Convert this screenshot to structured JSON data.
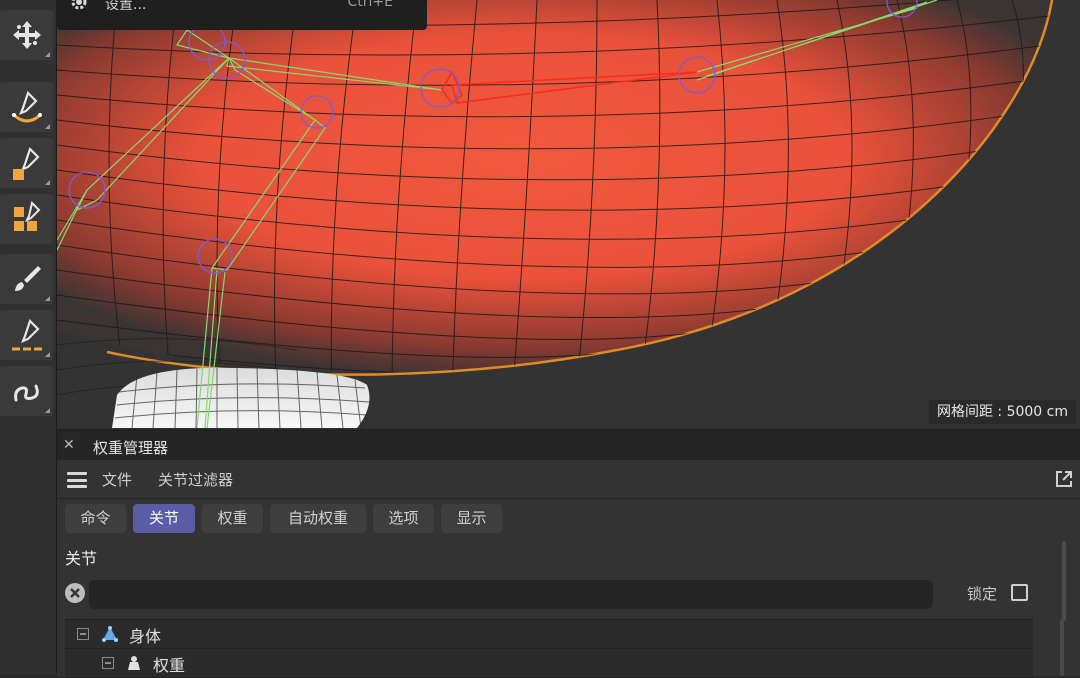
{
  "toolbar": {
    "tools": [
      {
        "name": "move-tool",
        "icon": "move-arrows-icon"
      },
      {
        "name": "smooth-brush-tool",
        "icon": "pen-smile-icon"
      },
      {
        "name": "pen-square-tool",
        "icon": "pen-square-icon"
      },
      {
        "name": "pen-cubes-tool",
        "icon": "pen-cubes-icon"
      },
      {
        "name": "paint-brush-tool",
        "icon": "brush-icon"
      },
      {
        "name": "pen-line-tool",
        "icon": "pen-line-icon"
      },
      {
        "name": "spline-tool",
        "icon": "squiggle-icon"
      }
    ]
  },
  "menu_overlay": {
    "label": "设置...",
    "shortcut": "Ctrl+E"
  },
  "viewport": {
    "grid_spacing": "网格间距 : 5000 cm"
  },
  "panel": {
    "title": "权重管理器",
    "menu": [
      "文件",
      "关节过滤器"
    ],
    "tabs": [
      "命令",
      "关节",
      "权重",
      "自动权重",
      "选项",
      "显示"
    ],
    "active_tab": "关节",
    "section_title": "关节",
    "search": {
      "value": "",
      "placeholder": ""
    },
    "lock_label": "锁定",
    "lock_checked": false,
    "tree": [
      {
        "label": "身体",
        "icon": "joint-icon",
        "depth": 0
      },
      {
        "label": "权重",
        "icon": "weight-icon",
        "depth": 1
      }
    ]
  },
  "colors": {
    "accent_tab": "#5a5ca6",
    "joint_selected": "#ff2a1a",
    "bone": "#7bd46a",
    "sphere": "#f05038"
  }
}
